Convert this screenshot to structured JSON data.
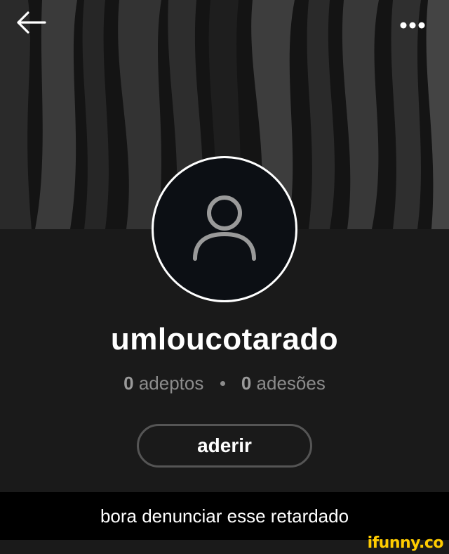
{
  "header": {
    "back_icon": "arrow-left-icon",
    "more_icon": "more-horizontal-icon"
  },
  "profile": {
    "avatar_icon": "user-placeholder-icon",
    "username": "umloucotarado",
    "followers_count": "0",
    "followers_label": "adeptos",
    "following_count": "0",
    "following_label": "adesões",
    "follow_button_label": "aderir"
  },
  "caption": {
    "text": "bora denunciar esse retardado"
  },
  "watermark": {
    "text": "ifunny.co"
  },
  "colors": {
    "cover_background": "#101010",
    "profile_background": "#1a1a1a",
    "avatar_fill": "#0c0f14",
    "stats_text": "#8c8c8c",
    "button_border": "#555555",
    "watermark": "#ffcc00"
  }
}
